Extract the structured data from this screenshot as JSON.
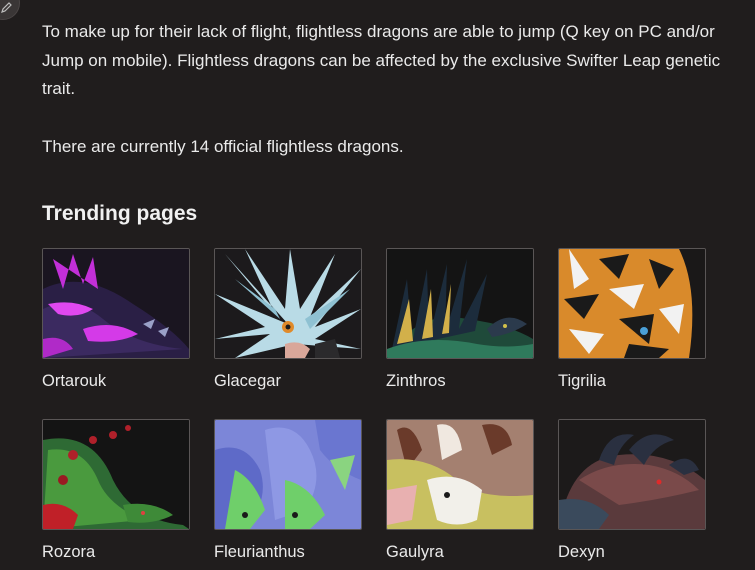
{
  "intro": {
    "paragraph1": "To make up for their lack of flight, flightless dragons are able to jump (Q key on PC and/or Jump on mobile). Flightless dragons can be affected by the exclusive Swifter Leap genetic trait.",
    "paragraph2": "There are currently 14 official flightless dragons."
  },
  "trending": {
    "heading": "Trending pages",
    "items": [
      {
        "label": "Ortarouk"
      },
      {
        "label": "Glacegar"
      },
      {
        "label": "Zinthros"
      },
      {
        "label": "Tigrilia"
      },
      {
        "label": "Rozora"
      },
      {
        "label": "Fleurianthus"
      },
      {
        "label": "Gaulyra"
      },
      {
        "label": "Dexyn"
      }
    ]
  },
  "colors": {
    "background": "#201d1d",
    "text": "#eaeaea",
    "thumb_border": "#5a5656"
  }
}
